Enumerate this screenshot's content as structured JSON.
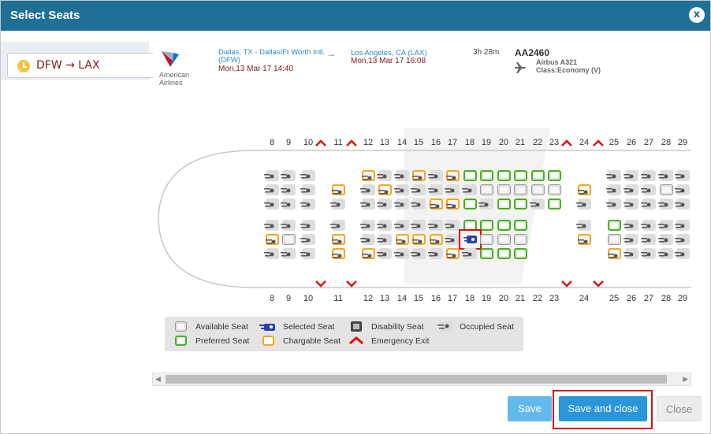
{
  "dialog": {
    "title": "Select Seats",
    "close_glyph": "x"
  },
  "sidebar": {
    "route_label": "DFW → LAX"
  },
  "flight": {
    "airline_name": "American Airlines",
    "from_city": "Dallas, TX - Dallas/Ft Worth Intl. (DFW)",
    "from_date": "Mon,13 Mar 17 14:40",
    "arrow": "→",
    "to_city": "Los Angeles, CA (LAX)",
    "to_date": "Mon,13 Mar 17 16:08",
    "duration": "3h 28m",
    "flight_number": "AA2460",
    "aircraft_model": "Airbus A321",
    "aircraft_class": "Class:Economy (V)"
  },
  "seatmap": {
    "columns": [
      "8",
      "9",
      "10",
      "11",
      "12",
      "13",
      "14",
      "15",
      "16",
      "17",
      "18",
      "19",
      "20",
      "21",
      "22",
      "23",
      "24",
      "25",
      "26",
      "27",
      "28",
      "29"
    ],
    "exit_markers": [
      "10-11 left",
      "11-12 left",
      "23-24 right",
      "24-25 right"
    ],
    "rows": [
      [
        "O",
        "O",
        "O",
        "",
        "C",
        "O",
        "O",
        "C",
        "O",
        "C",
        "P",
        "P",
        "P",
        "P",
        "P",
        "P",
        "",
        "O",
        "O",
        "O",
        "O",
        "O"
      ],
      [
        "O",
        "O",
        "O",
        "C",
        "O",
        "C",
        "O",
        "O",
        "O",
        "O",
        "O",
        "A",
        "A",
        "A",
        "A",
        "A",
        "C",
        "O",
        "O",
        "O",
        "A",
        "O"
      ],
      [
        "O",
        "O",
        "O",
        "O",
        "O",
        "O",
        "O",
        "O",
        "C",
        "C",
        "P",
        "O",
        "P",
        "P",
        "O",
        "P",
        "O",
        "O",
        "O",
        "O",
        "O",
        "O"
      ],
      [
        "O",
        "O",
        "O",
        "O",
        "O",
        "O",
        "O",
        "O",
        "O",
        "O",
        "P",
        "P",
        "P",
        "P",
        "",
        "",
        "O",
        "P",
        "O",
        "O",
        "O",
        "O"
      ],
      [
        "C",
        "A",
        "O",
        "C",
        "O",
        "O",
        "C",
        "C",
        "C",
        "O",
        "S",
        "A",
        "A",
        "A",
        "",
        "",
        "C",
        "A",
        "O",
        "O",
        "O",
        "O"
      ],
      [
        "O",
        "O",
        "O",
        "C",
        "C",
        "O",
        "O",
        "O",
        "O",
        "C",
        "O",
        "P",
        "P",
        "P",
        "",
        "",
        "",
        "C",
        "O",
        "O",
        "O",
        "O"
      ]
    ],
    "selected_seat": "18E"
  },
  "legend": {
    "available": "Available Seat",
    "selected": "Selected Seat",
    "disability": "Disability Seat",
    "occupied": "Occupied Seat",
    "preferred": "Preferred Seat",
    "chargeable": "Chargable Seat",
    "exit": "Emergency Exit"
  },
  "colors": {
    "header": "#1f6f96",
    "preferred": "#4ab01c",
    "chargeable": "#f4a71e",
    "selected": "#2b3fb5",
    "exit": "#d11",
    "primary_button": "#2b95d9"
  },
  "buttons": {
    "save": "Save",
    "save_close": "Save and close",
    "close": "Close"
  }
}
